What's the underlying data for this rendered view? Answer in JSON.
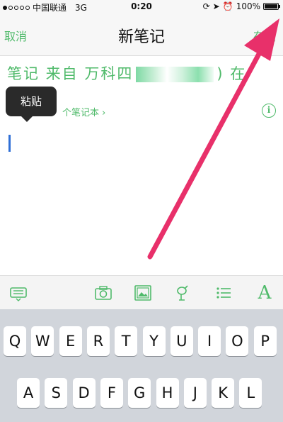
{
  "status_bar": {
    "carrier": "中国联通",
    "network": "3G",
    "time": "0:20",
    "battery": "100%"
  },
  "nav": {
    "cancel_label": "取消",
    "title": "新笔记",
    "save_label": "存储"
  },
  "note": {
    "title_prefix": "笔记 来自 万科四",
    "title_suffix": ") 在 "
  },
  "notebook": {
    "link_text": "个笔记本 ›"
  },
  "tooltip": {
    "paste_label": "粘贴"
  },
  "toolbar": {
    "items": [
      "keyboard-icon",
      "camera-icon",
      "image-icon",
      "handwriting-icon",
      "list-icon",
      "text-format-icon"
    ],
    "text_format_label": "A",
    "accent_color": "#4fba6a"
  },
  "keyboard": {
    "row1": [
      "Q",
      "W",
      "E",
      "R",
      "T",
      "Y",
      "U",
      "I",
      "O",
      "P"
    ],
    "row2": [
      "A",
      "S",
      "D",
      "F",
      "G",
      "H",
      "J",
      "K",
      "L"
    ]
  },
  "annotation": {
    "arrow_color": "#e8306a"
  }
}
